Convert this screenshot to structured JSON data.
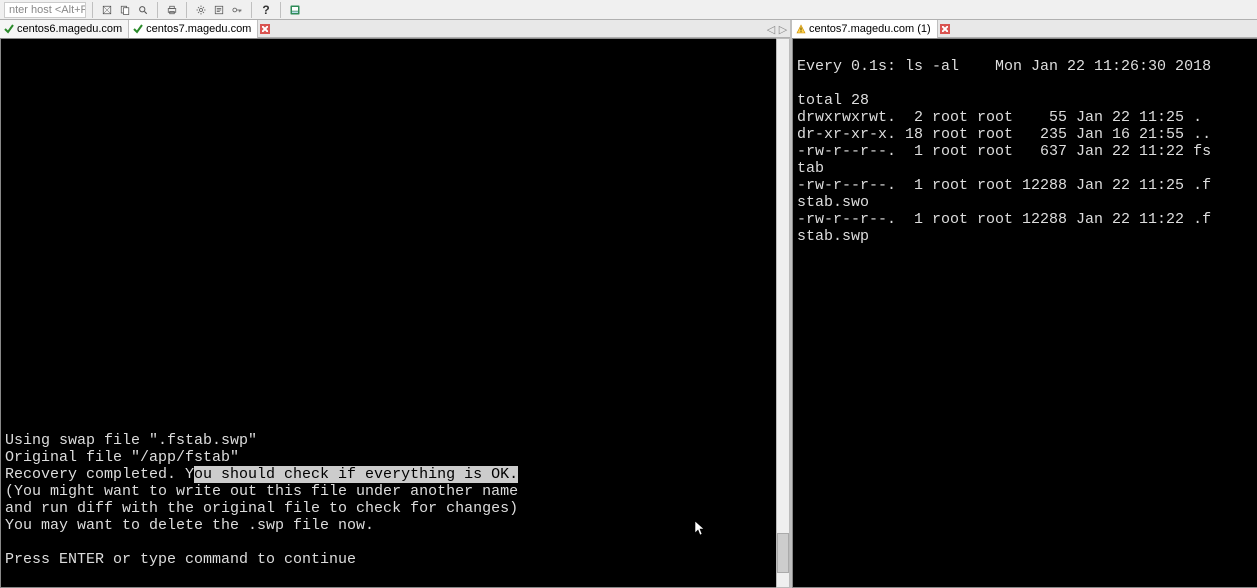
{
  "toolbar": {
    "host_placeholder": "nter host <Alt+R>",
    "help_glyph": "?"
  },
  "left": {
    "tabs": [
      {
        "icon": "check",
        "label": "centos6.magedu.com",
        "active": false
      },
      {
        "icon": "check",
        "label": "centos7.magedu.com",
        "active": true
      }
    ],
    "nav": {
      "left": "◁",
      "right": "▷"
    },
    "vim": {
      "line1": "Using swap file \".fstab.swp\"",
      "line2": "Original file \"/app/fstab\"",
      "line3_pre": "Recovery completed. Y",
      "line3_sel": "ou should check if everything is OK.",
      "line4": "(You might want to write out this file under another name",
      "line5": "and run diff with the original file to check for changes)",
      "line6": "You may want to delete the .swp file now.",
      "blank": "",
      "prompt": "Press ENTER or type command to continue"
    }
  },
  "right": {
    "tabs": [
      {
        "icon": "warn",
        "label": "centos7.magedu.com (1)",
        "active": true
      }
    ],
    "watch": {
      "header": "Every 0.1s: ls -al    Mon Jan 22 11:26:30 2018",
      "lines": [
        "",
        "total 28",
        "drwxrwxrwt.  2 root root    55 Jan 22 11:25 .",
        "dr-xr-xr-x. 18 root root   235 Jan 16 21:55 ..",
        "-rw-r--r--.  1 root root   637 Jan 22 11:22 fs",
        "tab",
        "-rw-r--r--.  1 root root 12288 Jan 22 11:25 .f",
        "stab.swo",
        "-rw-r--r--.  1 root root 12288 Jan 22 11:22 .f",
        "stab.swp"
      ]
    }
  }
}
